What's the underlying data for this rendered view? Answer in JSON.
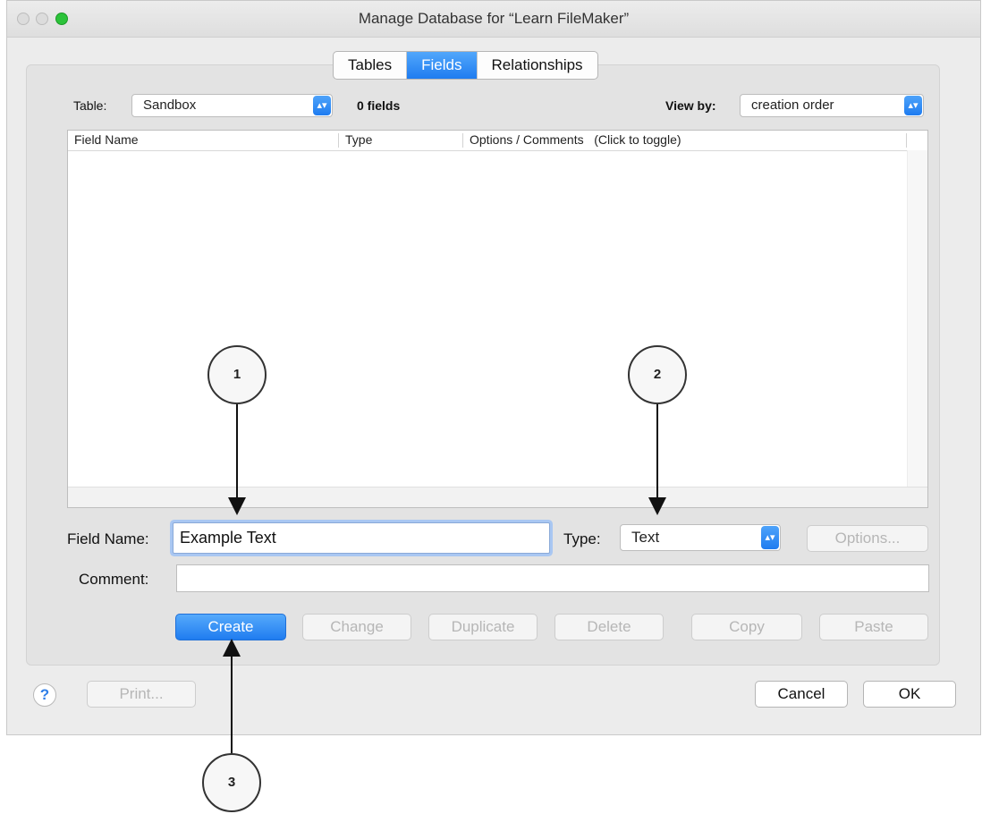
{
  "window": {
    "title": "Manage Database for “Learn FileMaker”"
  },
  "tabs": [
    {
      "label": "Tables",
      "active": false
    },
    {
      "label": "Fields",
      "active": true
    },
    {
      "label": "Relationships",
      "active": false
    }
  ],
  "table_selector": {
    "label": "Table:",
    "value": "Sandbox",
    "field_count": "0 fields"
  },
  "view_by": {
    "label": "View by:",
    "value": "creation order"
  },
  "field_list": {
    "columns": [
      "Field Name",
      "Type",
      "Options / Comments   (Click to toggle)"
    ],
    "rows": []
  },
  "field_form": {
    "name_label": "Field Name:",
    "name_value": "Example Text",
    "type_label": "Type:",
    "type_value": "Text",
    "options_button": "Options...",
    "comment_label": "Comment:",
    "comment_value": ""
  },
  "action_buttons": {
    "create": "Create",
    "change": "Change",
    "duplicate": "Duplicate",
    "delete": "Delete",
    "copy": "Copy",
    "paste": "Paste"
  },
  "footer": {
    "help": "?",
    "print": "Print...",
    "cancel": "Cancel",
    "ok": "OK"
  },
  "callouts": [
    "1",
    "2",
    "3"
  ],
  "colors": {
    "accent": "#1f7cf0",
    "zoom_button": "#2cc33a",
    "focus_ring": "#a9c7f2"
  },
  "icons": {
    "help": "help-icon",
    "popup_stepper": "chevron-up-down-icon"
  }
}
